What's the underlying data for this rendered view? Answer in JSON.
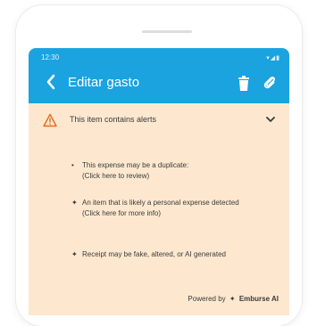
{
  "status_bar": {
    "time": "12:30",
    "icons": "▾◢▮"
  },
  "appbar": {
    "title": "Editar gasto",
    "back_icon": "chevron-left-icon",
    "trash_icon": "trash-icon",
    "attach_icon": "paperclip-icon",
    "color": "#1aa3df"
  },
  "alert_panel": {
    "background": "#fde8cf",
    "title": "This item contains alerts",
    "items": [
      {
        "marker": "•",
        "text": "This expense may be a duplicate:",
        "link": "(Click here to review)"
      },
      {
        "marker": "✦",
        "text": "An item that is likely a personal expense detected",
        "link": "(Click here for more info)"
      },
      {
        "marker": "✦",
        "text": "Receipt may be fake, altered, or AI generated",
        "link": ""
      }
    ],
    "powered_prefix": "Powered by",
    "powered_brand": "Emburse AI"
  }
}
